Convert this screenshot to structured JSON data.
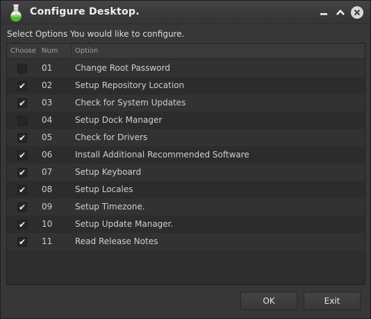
{
  "window": {
    "title": "Configure Desktop."
  },
  "instructions": "Select Options You would like to configure.",
  "table": {
    "columns": {
      "choose": "Choose",
      "num": "Num",
      "option": "Option"
    },
    "rows": [
      {
        "num": "01",
        "option": "Change Root Password",
        "checked": false
      },
      {
        "num": "02",
        "option": "Setup Repository Location",
        "checked": true
      },
      {
        "num": "03",
        "option": "Check for System Updates",
        "checked": true
      },
      {
        "num": "04",
        "option": "Setup Dock Manager",
        "checked": false
      },
      {
        "num": "05",
        "option": "Check for Drivers",
        "checked": true
      },
      {
        "num": "06",
        "option": "Install Additional Recommended Software",
        "checked": true
      },
      {
        "num": "07",
        "option": "Setup Keyboard",
        "checked": true
      },
      {
        "num": "08",
        "option": "Setup Locales",
        "checked": true
      },
      {
        "num": "09",
        "option": "Setup Timezone.",
        "checked": true
      },
      {
        "num": "10",
        "option": "Setup Update Manager.",
        "checked": true
      },
      {
        "num": "11",
        "option": "Read Release Notes",
        "checked": true
      }
    ]
  },
  "buttons": {
    "ok": "OK",
    "exit": "Exit"
  },
  "icons": {
    "app": "flask-icon",
    "minimize": "minimize-icon",
    "maximize": "chevron-up-icon",
    "close": "close-icon",
    "check": "checkmark-icon"
  },
  "colors": {
    "window_bg": "#373737",
    "flask_liquid": "#3ec21e"
  }
}
